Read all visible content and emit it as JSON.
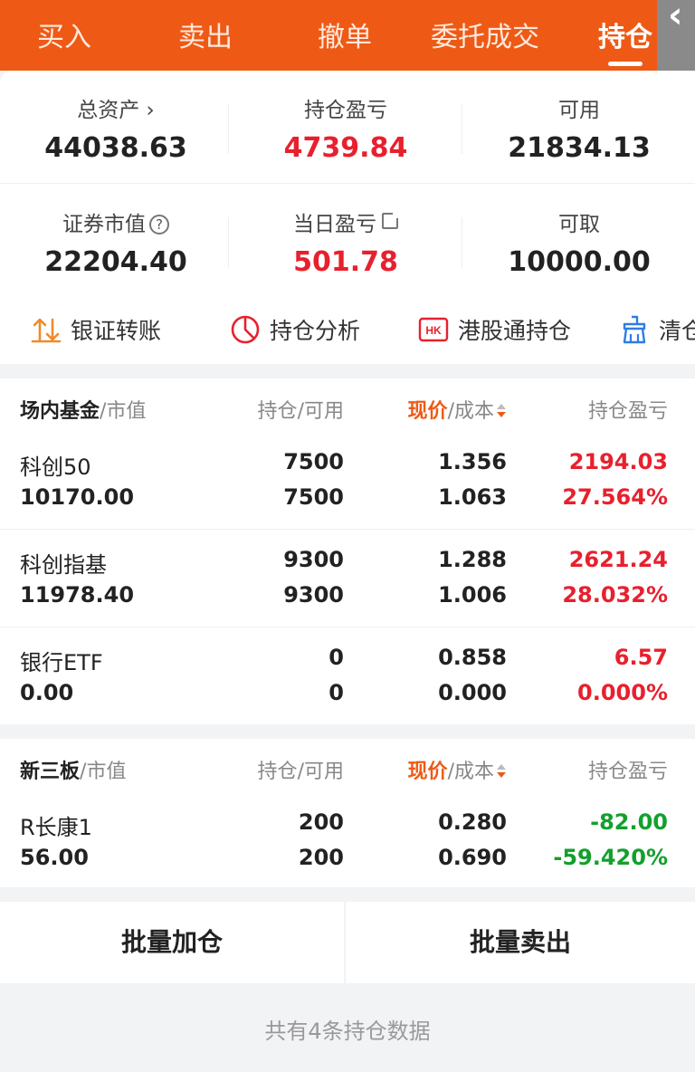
{
  "tabs": [
    "买入",
    "卖出",
    "撤单",
    "委托成交",
    "持仓"
  ],
  "back_icon": "‹",
  "summary": {
    "total_assets": {
      "label": "总资产",
      "value": "44038.63"
    },
    "position_pnl": {
      "label": "持仓盈亏",
      "value": "4739.84"
    },
    "available": {
      "label": "可用",
      "value": "21834.13"
    },
    "market_value": {
      "label": "证券市值",
      "value": "22204.40"
    },
    "daily_pnl": {
      "label": "当日盈亏",
      "value": "501.78"
    },
    "withdrawable": {
      "label": "可取",
      "value": "10000.00"
    }
  },
  "actions": [
    "银证转账",
    "持仓分析",
    "港股通持仓",
    "清仓"
  ],
  "hk_badge": "HK",
  "header_labels": {
    "holding": "持仓",
    "available": "可用",
    "price": "现价",
    "cost": "成本",
    "pnl": "持仓盈亏",
    "mv": "市值"
  },
  "sections": [
    {
      "category": "场内基金",
      "rows": [
        {
          "name": "科创50",
          "market_value": "10170.00",
          "holding": "7500",
          "available": "7500",
          "price": "1.356",
          "cost": "1.063",
          "pnl": "2194.03",
          "pnl_pct": "27.564%"
        },
        {
          "name": "科创指基",
          "market_value": "11978.40",
          "holding": "9300",
          "available": "9300",
          "price": "1.288",
          "cost": "1.006",
          "pnl": "2621.24",
          "pnl_pct": "28.032%"
        },
        {
          "name": "银行ETF",
          "market_value": "0.00",
          "holding": "0",
          "available": "0",
          "price": "0.858",
          "cost": "0.000",
          "pnl": "6.57",
          "pnl_pct": "0.000%"
        }
      ]
    },
    {
      "category": "新三板",
      "rows": [
        {
          "name": "R长康1",
          "market_value": "56.00",
          "holding": "200",
          "available": "200",
          "price": "0.280",
          "cost": "0.690",
          "pnl": "-82.00",
          "pnl_pct": "-59.420%"
        }
      ]
    }
  ],
  "buttons": {
    "add": "批量加仓",
    "sell": "批量卖出"
  },
  "footer": "共有4条持仓数据",
  "colors": {
    "brand": "#ee5a16",
    "profit": "#e8202e",
    "loss": "#13a02d"
  }
}
